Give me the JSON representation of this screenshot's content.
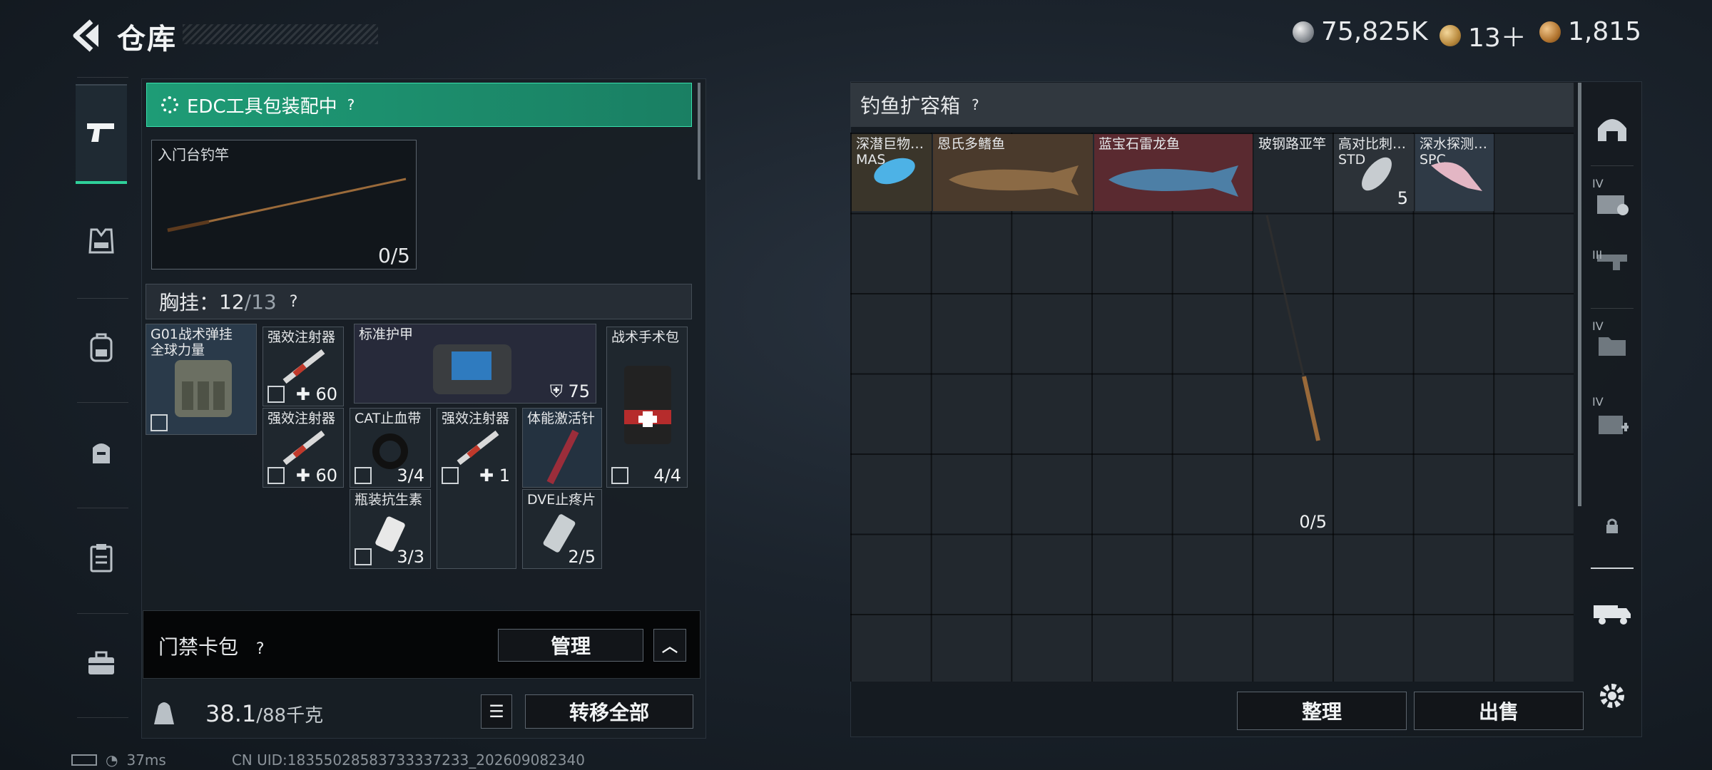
{
  "header": {
    "title": "仓库",
    "currencies": [
      {
        "icon": "silver-coin-icon",
        "value": "75,825K"
      },
      {
        "icon": "gold-token-icon",
        "value": "13＋"
      },
      {
        "icon": "bronze-coin-icon",
        "value": "1,815"
      }
    ]
  },
  "left_nav": {
    "tabs": [
      {
        "name": "pistol-icon",
        "active": true
      },
      {
        "name": "vest-icon"
      },
      {
        "name": "backpack-icon"
      },
      {
        "name": "pouch-icon"
      },
      {
        "name": "clipboard-icon"
      },
      {
        "name": "toolbox-icon"
      }
    ]
  },
  "loadout": {
    "edc_label": "EDC工具包装配中",
    "rod_card": {
      "label": "入门台钓竿",
      "count": "0/5"
    },
    "chest": {
      "label": "胸挂：",
      "used": "12",
      "total": "/13"
    },
    "items": [
      {
        "name": "G01战术弹挂",
        "sub": "全球力量"
      },
      {
        "name": "强效注射器",
        "count": "60"
      },
      {
        "name": "强效注射器",
        "count": "60"
      },
      {
        "name": "标准护甲",
        "count": "75"
      },
      {
        "name": "战术手术包",
        "count": "4/4"
      },
      {
        "name": "CAT止血带",
        "count": "3/4"
      },
      {
        "name": "强效注射器",
        "count": "1"
      },
      {
        "name": "体能激活针",
        "count": ""
      },
      {
        "name": "瓶装抗生素",
        "count": "3/3"
      },
      {
        "name": "DVE止疼片",
        "count": "2/5"
      }
    ],
    "card_bag": {
      "label": "门禁卡包",
      "manage": "管理"
    },
    "weight": {
      "value": "38.1",
      "total": "/88千克"
    },
    "transfer_all": "转移全部"
  },
  "container": {
    "title": "钓鱼扩容箱",
    "slots": [
      {
        "name": "深潜巨物…",
        "sub": "MAS"
      },
      {
        "name": "恩氏多鳍鱼"
      },
      {
        "name": "蓝宝石雷龙鱼"
      },
      {
        "name": "玻钢路亚竿",
        "count": "0/5"
      },
      {
        "name": "高对比刺…",
        "sub": "STD",
        "count": "5"
      },
      {
        "name": "深水探测…",
        "sub": "SPC"
      }
    ],
    "organize": "整理",
    "sell": "出售"
  },
  "right_nav": {
    "items": [
      {
        "name": "helmet-icon"
      },
      {
        "name": "rig-slot-icon",
        "tier": "IV"
      },
      {
        "name": "weapon-slot-icon",
        "tier": "III"
      },
      {
        "name": "folder-slot-icon",
        "tier": "IV"
      },
      {
        "name": "medkit-slot-icon",
        "tier": "IV"
      },
      {
        "name": "lock-icon"
      },
      {
        "name": "truck-icon"
      },
      {
        "name": "settings-gear-icon"
      }
    ]
  },
  "status": {
    "ping": "37ms",
    "uid": "CN UID:18355028583733337233_202609082340"
  },
  "colors": {
    "accent_green": "#2fd09a",
    "panel": "#181e25",
    "fish_brown": "#4a3a2c",
    "fish_red": "#5a2a30"
  }
}
